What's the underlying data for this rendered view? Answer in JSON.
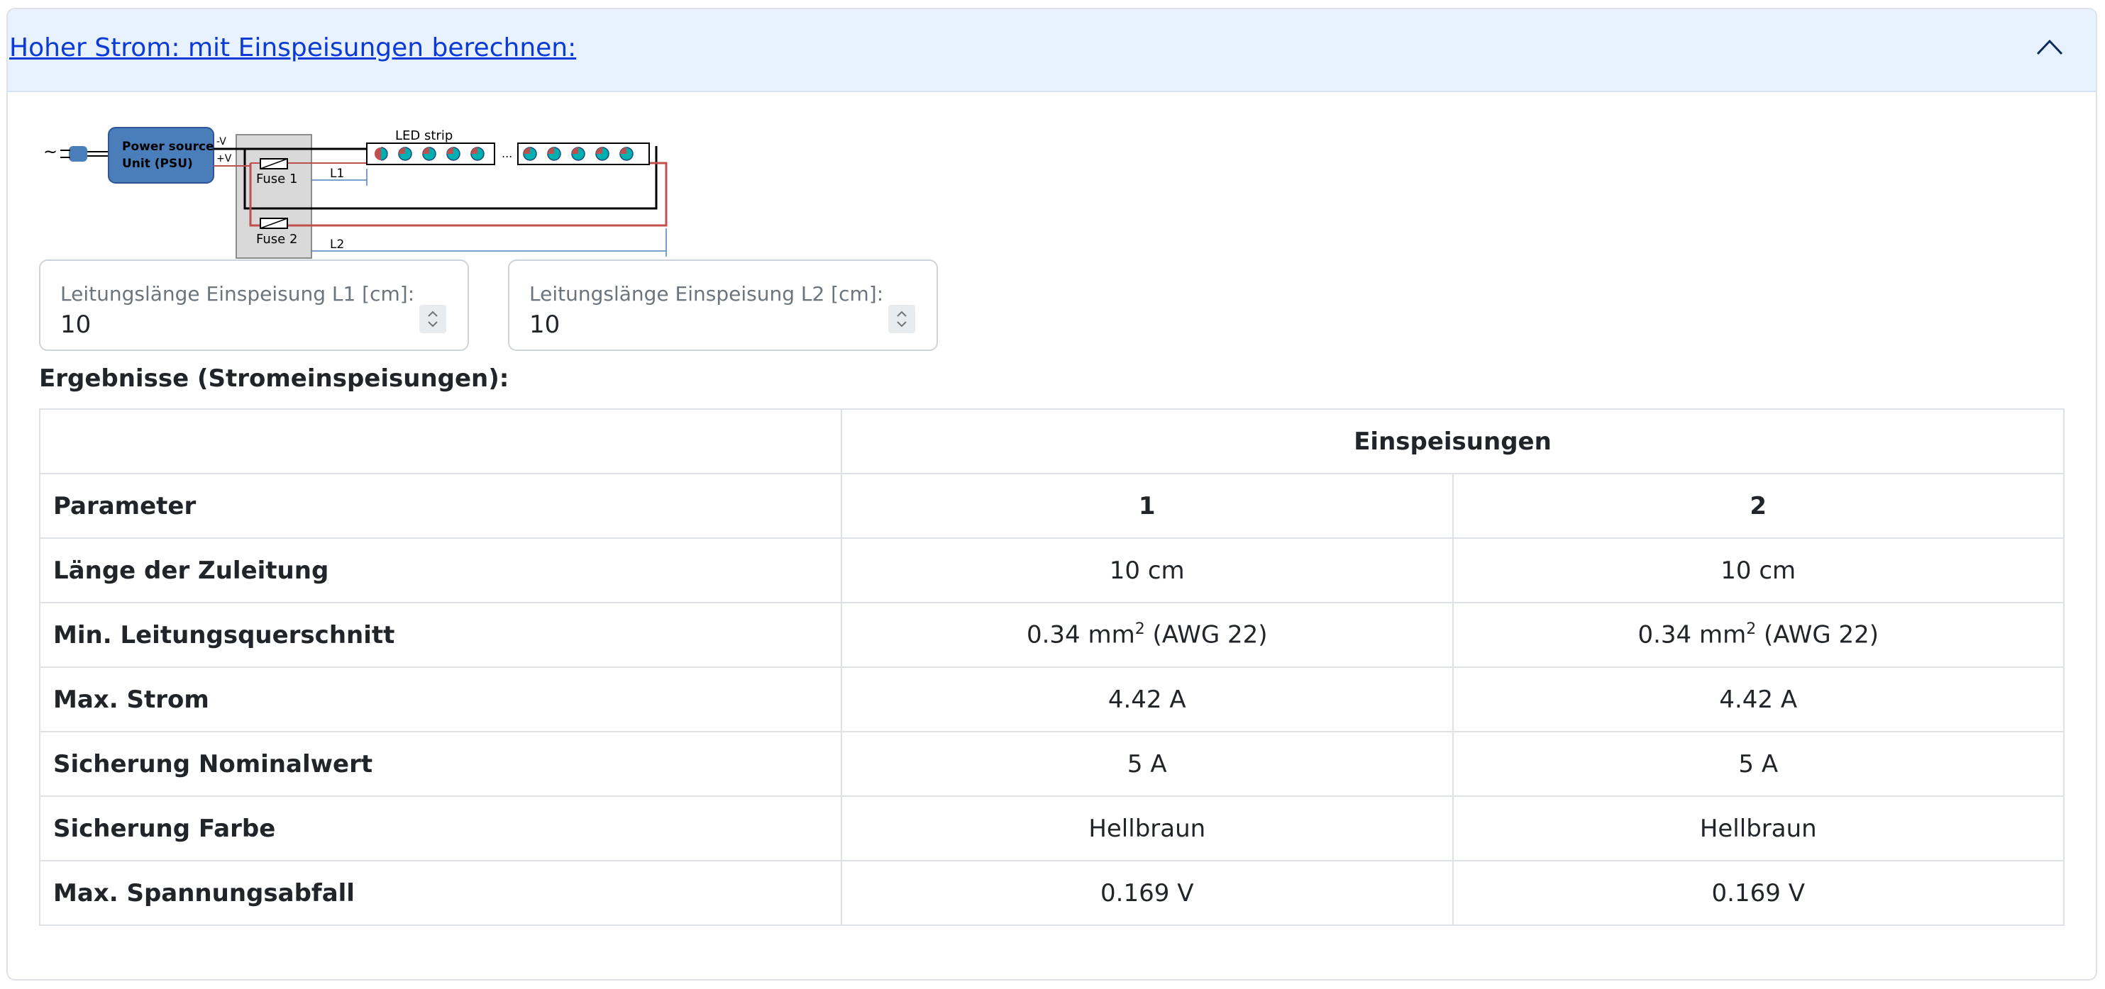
{
  "accordion": {
    "title": "Hoher Strom: mit Einspeisungen berechnen:",
    "toggle_icon": "chevron-up-icon"
  },
  "diagram": {
    "psu_line1": "Power source",
    "psu_line2": "Unit (PSU)",
    "minus_v": "-V",
    "plus_v": "+V",
    "ac_symbol": "~",
    "fuse1": "Fuse 1",
    "fuse2": "Fuse 2",
    "strip_label": "LED strip",
    "ellipsis": "...",
    "l1": "L1",
    "l2": "L2",
    "colors": {
      "psu": "#4a7ebb",
      "wire_neg": "#000000",
      "wire_pos": "#c0504d",
      "dimension": "#4f81bd",
      "fuse_box": "#d9d9d9"
    }
  },
  "inputs": {
    "l1": {
      "label": "Leitungslänge Einspeisung L1 [cm]:",
      "value": "10"
    },
    "l2": {
      "label": "Leitungslänge Einspeisung L2 [cm]:",
      "value": "10"
    }
  },
  "results": {
    "heading": "Ergebnisse (Stromeinspeisungen):",
    "group_header": "Einspeisungen",
    "param_header": "Parameter",
    "feed_headers": [
      "1",
      "2"
    ],
    "rows": [
      {
        "param": "Länge der Zuleitung",
        "v1": "10 cm",
        "v2": "10 cm"
      },
      {
        "param": "Min. Leitungsquerschnitt",
        "v1_pre": "0.34 mm",
        "v1_sup": "2",
        "v1_post": " (AWG 22)",
        "v2_pre": "0.34 mm",
        "v2_sup": "2",
        "v2_post": " (AWG 22)"
      },
      {
        "param": "Max. Strom",
        "v1": "4.42 A",
        "v2": "4.42 A"
      },
      {
        "param": "Sicherung Nominalwert",
        "v1": "5 A",
        "v2": "5 A"
      },
      {
        "param": "Sicherung Farbe",
        "v1": "Hellbraun",
        "v2": "Hellbraun"
      },
      {
        "param": "Max. Spannungsabfall",
        "v1": "0.169 V",
        "v2": "0.169 V"
      }
    ]
  }
}
